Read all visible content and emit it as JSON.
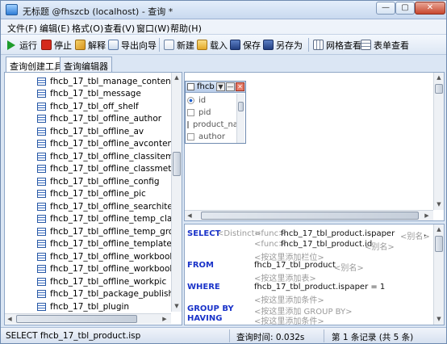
{
  "window": {
    "title": "无标题 @fhszcb (localhost) - 查询 *",
    "controls": {
      "minimize": "—",
      "maximize": "▢",
      "close": "✕"
    }
  },
  "menu": [
    "文件(F)",
    "编辑(E)",
    "格式(O)",
    "查看(V)",
    "窗口(W)",
    "帮助(H)"
  ],
  "toolbar": {
    "run": "运行",
    "stop": "停止",
    "explain": "解释",
    "export": "导出向导",
    "new": "新建",
    "load": "载入",
    "save": "保存",
    "save_as": "另存为",
    "grid_view": "网格查看",
    "form_view": "表单查看"
  },
  "tabs": [
    "查询创建工具",
    "查询编辑器"
  ],
  "tree_items": [
    "fhcb_17_tbl_manage_content",
    "fhcb_17_tbl_message",
    "fhcb_17_tbl_off_shelf",
    "fhcb_17_tbl_offline_author",
    "fhcb_17_tbl_offline_av",
    "fhcb_17_tbl_offline_avcontent",
    "fhcb_17_tbl_offline_classitem",
    "fhcb_17_tbl_offline_classmethod",
    "fhcb_17_tbl_offline_config",
    "fhcb_17_tbl_offline_pic",
    "fhcb_17_tbl_offline_searchitem",
    "fhcb_17_tbl_offline_temp_class",
    "fhcb_17_tbl_offline_temp_group",
    "fhcb_17_tbl_offline_template",
    "fhcb_17_tbl_offline_workbook",
    "fhcb_17_tbl_offline_workbook_aut",
    "fhcb_17_tbl_offline_workpic",
    "fhcb_17_tbl_package_publish_mar",
    "fhcb_17_tbl_plugin"
  ],
  "table_window": {
    "name": "fhcb",
    "columns": [
      "id",
      "pid",
      "product_na",
      "author"
    ]
  },
  "sql": {
    "select_kw": "SELECT",
    "distinct": "<Distinct>",
    "func": "<func>",
    "field1": "fhcb_17_tbl_product.ispaper",
    "alias": "<别名>",
    "comma": ",",
    "field2": "fhcb_17_tbl_product.id",
    "add_field": "<按这里添加栏位>",
    "from_kw": "FROM",
    "from_table": "fhcb_17_tbl_product",
    "add_table": "<按这里添加表>",
    "where_kw": "WHERE",
    "where_cond": "fhcb_17_tbl_product.ispaper = 1",
    "add_cond": "<按这里添加条件>",
    "groupby_kw": "GROUP BY",
    "add_groupby": "<按这里添加 GROUP BY>",
    "having_kw": "HAVING",
    "add_having": "<按这里添加条件>"
  },
  "status": {
    "query": "SELECT fhcb_17_tbl_product.isp",
    "time": "查询时间: 0.032s",
    "records": "第 1 条记录 (共 5 条)"
  }
}
